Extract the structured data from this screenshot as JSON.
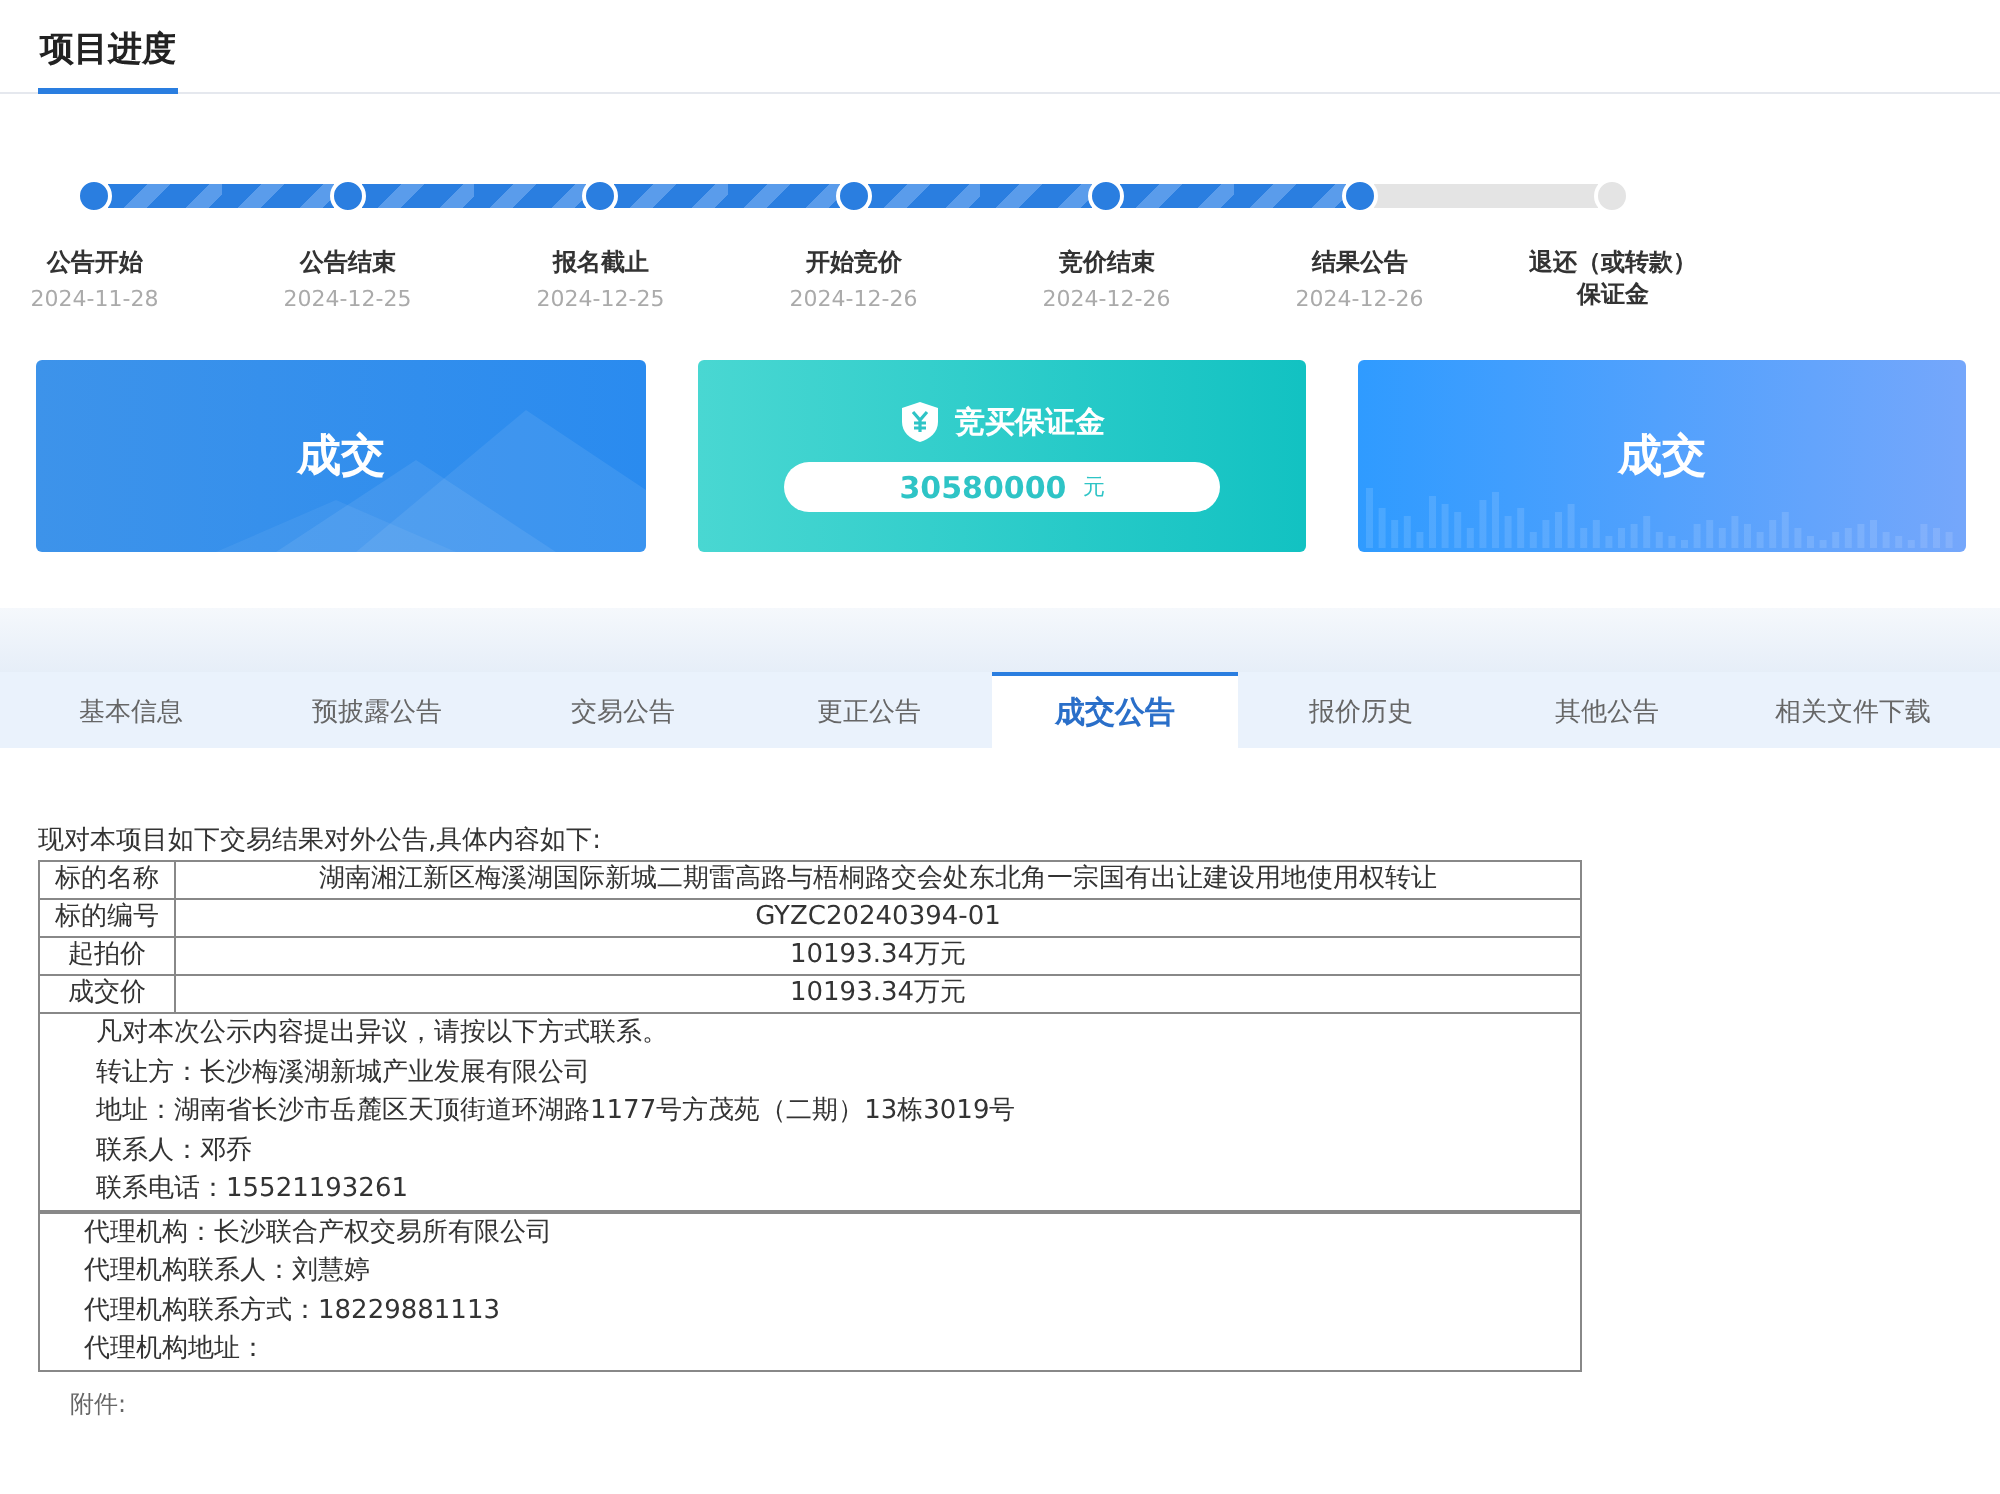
{
  "header": {
    "title": "项目进度"
  },
  "timeline": [
    {
      "label": "公告开始",
      "date": "2024-11-28",
      "done": true
    },
    {
      "label": "公告结束",
      "date": "2024-12-25",
      "done": true
    },
    {
      "label": "报名截止",
      "date": "2024-12-25",
      "done": true
    },
    {
      "label": "开始竞价",
      "date": "2024-12-26",
      "done": true
    },
    {
      "label": "竞价结束",
      "date": "2024-12-26",
      "done": true
    },
    {
      "label": "结果公告",
      "date": "2024-12-26",
      "done": true
    },
    {
      "label": "退还（或转款）保证金",
      "done": false
    }
  ],
  "cards": [
    {
      "kind": "status",
      "text": "成交"
    },
    {
      "kind": "deposit",
      "title": "竞买保证金",
      "amount": "30580000",
      "unit": "元"
    },
    {
      "kind": "status_chart",
      "text": "成交"
    }
  ],
  "tabs": [
    {
      "label": "基本信息",
      "selected": false
    },
    {
      "label": "预披露公告",
      "selected": false
    },
    {
      "label": "交易公告",
      "selected": false
    },
    {
      "label": "更正公告",
      "selected": false
    },
    {
      "label": "成交公告",
      "selected": true
    },
    {
      "label": "报价历史",
      "selected": false
    },
    {
      "label": "其他公告",
      "selected": false
    },
    {
      "label": "相关文件下载",
      "selected": false
    }
  ],
  "notice": {
    "intro": "现对本项目如下交易结果对外公告,具体内容如下:",
    "rows": [
      {
        "label": "标的名称",
        "value": "湖南湘江新区梅溪湖国际新城二期雷高路与梧桐路交会处东北角一宗国有出让建设用地使用权转让"
      },
      {
        "label": "标的编号",
        "value": "GYZC20240394-01"
      },
      {
        "label": "起拍价",
        "value": "10193.34万元"
      },
      {
        "label": "成交价",
        "value": "10193.34万元"
      }
    ],
    "contact_lines": [
      "凡对本次公示内容提出异议，请按以下方式联系。",
      "转让方：长沙梅溪湖新城产业发展有限公司",
      "地址：湖南省长沙市岳麓区天顶街道环湖路1177号方茂苑（二期）13栋3019号",
      "联系人：邓乔",
      "联系电话：15521193261"
    ],
    "agent_lines": [
      "代理机构：长沙联合产权交易所有限公司",
      "代理机构联系人：刘慧婷",
      "代理机构联系方式：18229881113",
      "代理机构地址："
    ],
    "attachment_label": "附件:"
  }
}
